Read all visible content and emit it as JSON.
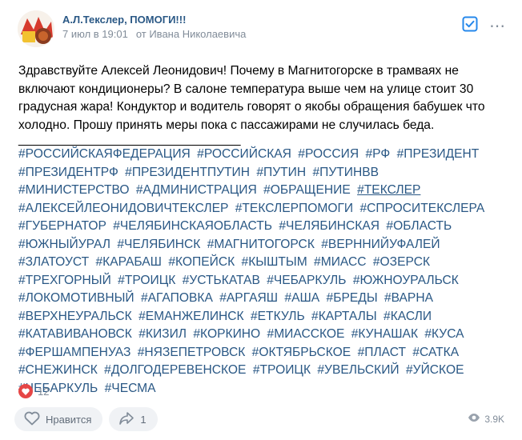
{
  "post": {
    "author": "А.Л.Текслер, ПОМОГИ!!!",
    "date": "7 июл в 19:01",
    "source": "от Ивана Николаевича",
    "text": "Здравствуйте Алексей Леонидович! Почему в Магнитогорске в трамваях не включают кондиционеры? В салоне температура выше чем на улице стоит 30 градусная жара! Кондуктор и водитель говорят о якобы обращения бабушек что холодно. Прошу принять меры пока с пассажирами не случилась беда.",
    "divider": "________________________________",
    "hashtags": [
      "#РОССИЙСКАЯФЕДЕРАЦИЯ",
      "#РОССИЙСКАЯ",
      "#РОССИЯ",
      "#РФ",
      "#ПРЕЗИДЕНТ",
      "#ПРЕЗИДЕНТРФ",
      "#ПРЕЗИДЕНТПУТИН",
      "#ПУТИН",
      "#ПУТИНВВ",
      "#МИНИСТЕРСТВО",
      "#АДМИНИСТРАЦИЯ",
      "#ОБРАЩЕНИЕ",
      "#ТЕКСЛЕР",
      "#АЛЕКСЕЙЛЕОНИДОВИЧТЕКСЛЕР",
      "#ТЕКСЛЕРПОМОГИ",
      "#СПРОСИТЕКСЛЕРА",
      "#ГУБЕРНАТОР",
      "#ЧЕЛЯБИНСКАЯОБЛАСТЬ",
      "#ЧЕЛЯБИНСКАЯ",
      "#ОБЛАСТЬ",
      "#ЮЖНЫЙУРАЛ",
      "#ЧЕЛЯБИНСК",
      "#МАГНИТОГОРСК",
      "#ВЕРННИЙУФАЛЕЙ",
      "#ЗЛАТОУСТ",
      "#КАРАБАШ",
      "#КОПЕЙСК",
      "#КЫШТЫМ",
      "#МИАСС",
      "#ОЗЕРСК",
      "#ТРЕХГОРНЫЙ",
      "#ТРОИЦК",
      "#УСТЬКАТАВ",
      "#ЧЕБАРКУЛЬ",
      "#ЮЖНОУРАЛЬСК",
      "#ЛОКОМОТИВНЫЙ",
      "#АГАПОВКА",
      "#АРГАЯШ",
      "#АША",
      "#БРЕДЫ",
      "#ВАРНА",
      "#ВЕРХНЕУРАЛЬСК",
      "#ЕМАНЖЕЛИНСК",
      "#ЕТКУЛЬ",
      "#КАРТАЛЫ",
      "#КАСЛИ",
      "#КАТАВИВАНОВСК",
      "#КИЗИЛ",
      "#КОРКИНО",
      "#МИАССКОЕ",
      "#КУНАШАК",
      "#КУСА",
      "#ФЕРШАМПЕНУАЗ",
      "#НЯЗЕПЕТРОВСК",
      "#ОКТЯБРЬСКОЕ",
      "#ПЛАСТ",
      "#САТКА",
      "#СНЕЖИНСК",
      "#ДОЛГОДЕРЕВЕНСКОЕ",
      "#ТРОИЦК",
      "#УВЕЛЬСКИЙ",
      "#УЙСКОЕ",
      "#ЧЕБАРКУЛЬ",
      "#ЧЕСМА"
    ],
    "underlined_tag": "#ТЕКСЛЕР"
  },
  "reactions": {
    "count": "12"
  },
  "actions": {
    "like_label": "Нравится",
    "share_count": "1"
  },
  "views": {
    "count": "3.9K"
  },
  "colors": {
    "link": "#2a5885",
    "heart": "#e64646",
    "accent": "#2688eb"
  },
  "icons": [
    "avatar",
    "check-icon",
    "more-icon",
    "heart-icon",
    "share-icon",
    "eye-icon"
  ]
}
